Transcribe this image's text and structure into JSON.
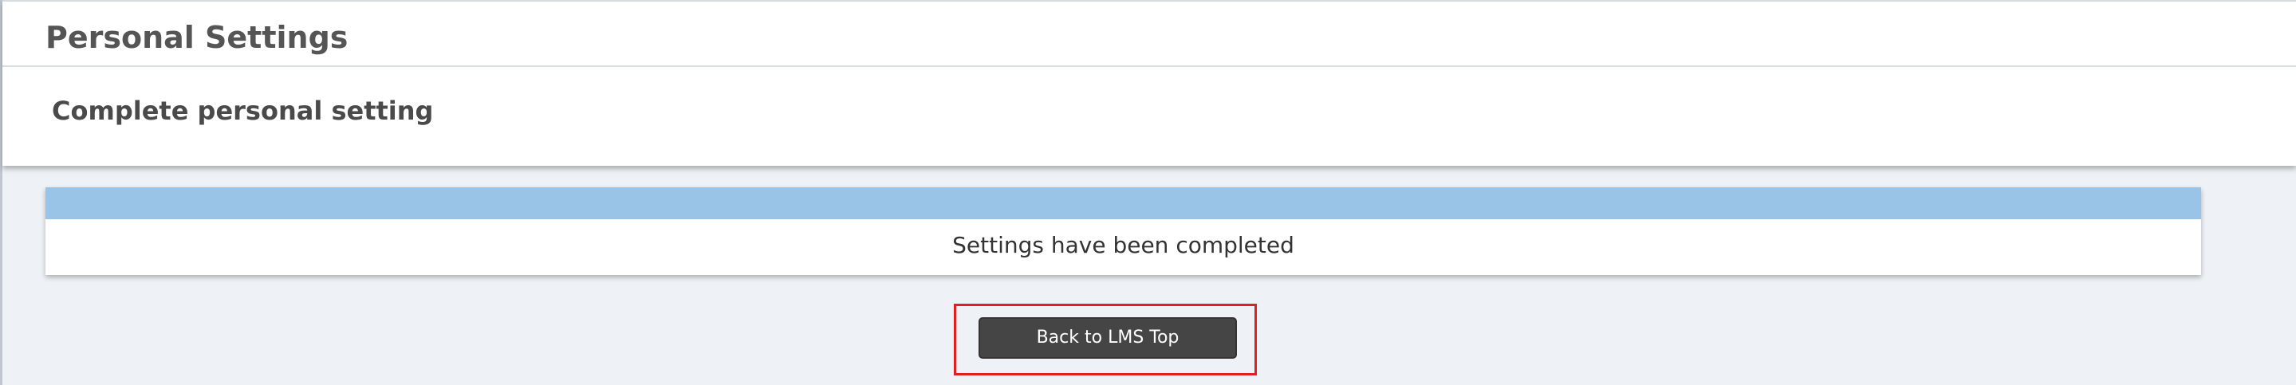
{
  "header": {
    "title": "Personal Settings"
  },
  "section": {
    "title": "Complete personal setting"
  },
  "message": {
    "text": "Settings have been completed"
  },
  "actions": {
    "back_label": "Back to LMS Top"
  },
  "colors": {
    "page_background": "#eef2f6",
    "card_strip": "#99c4e8",
    "button_background": "#454545",
    "highlight_border": "#e02020"
  }
}
